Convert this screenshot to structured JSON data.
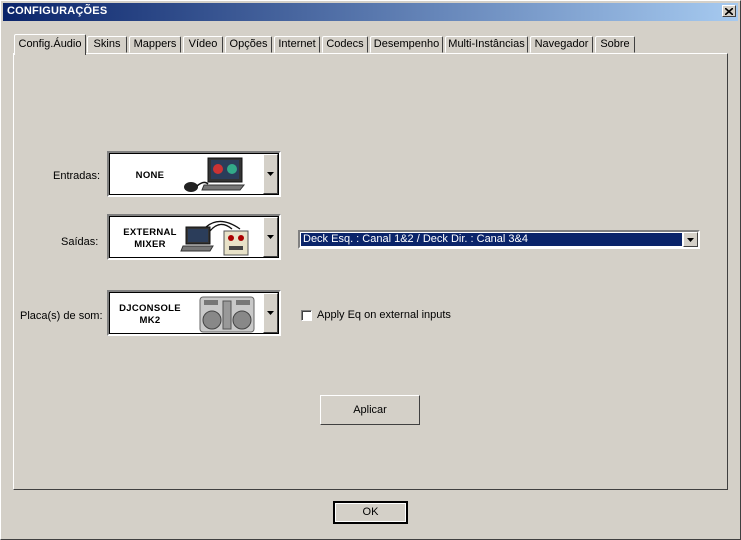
{
  "window": {
    "title": "CONFIGURAÇÕES"
  },
  "tabs": [
    {
      "label": "Config.Áudio",
      "active": true
    },
    {
      "label": "Skins"
    },
    {
      "label": "Mappers"
    },
    {
      "label": "Vídeo"
    },
    {
      "label": "Opções"
    },
    {
      "label": "Internet"
    },
    {
      "label": "Codecs"
    },
    {
      "label": "Desempenho"
    },
    {
      "label": "Multi-Instâncias"
    },
    {
      "label": "Navegador"
    },
    {
      "label": "Sobre"
    }
  ],
  "audio": {
    "inputs": {
      "label": "Entradas:",
      "value": "NONE"
    },
    "outputs": {
      "label": "Saídas:",
      "value": "EXTERNAL MIXER",
      "routing": "Deck Esq. : Canal 1&2 / Deck Dir. : Canal 3&4"
    },
    "soundcard": {
      "label": "Placa(s) de som:",
      "value": "DJCONSOLE MK2"
    },
    "apply_eq": {
      "label": "Apply Eq on external inputs",
      "checked": false
    },
    "apply_button": "Aplicar"
  },
  "footer": {
    "ok_button": "OK"
  },
  "colors": {
    "title_start": "#0a246a",
    "title_end": "#a6caf0",
    "face": "#d4d0c8",
    "selection": "#0a246a"
  }
}
